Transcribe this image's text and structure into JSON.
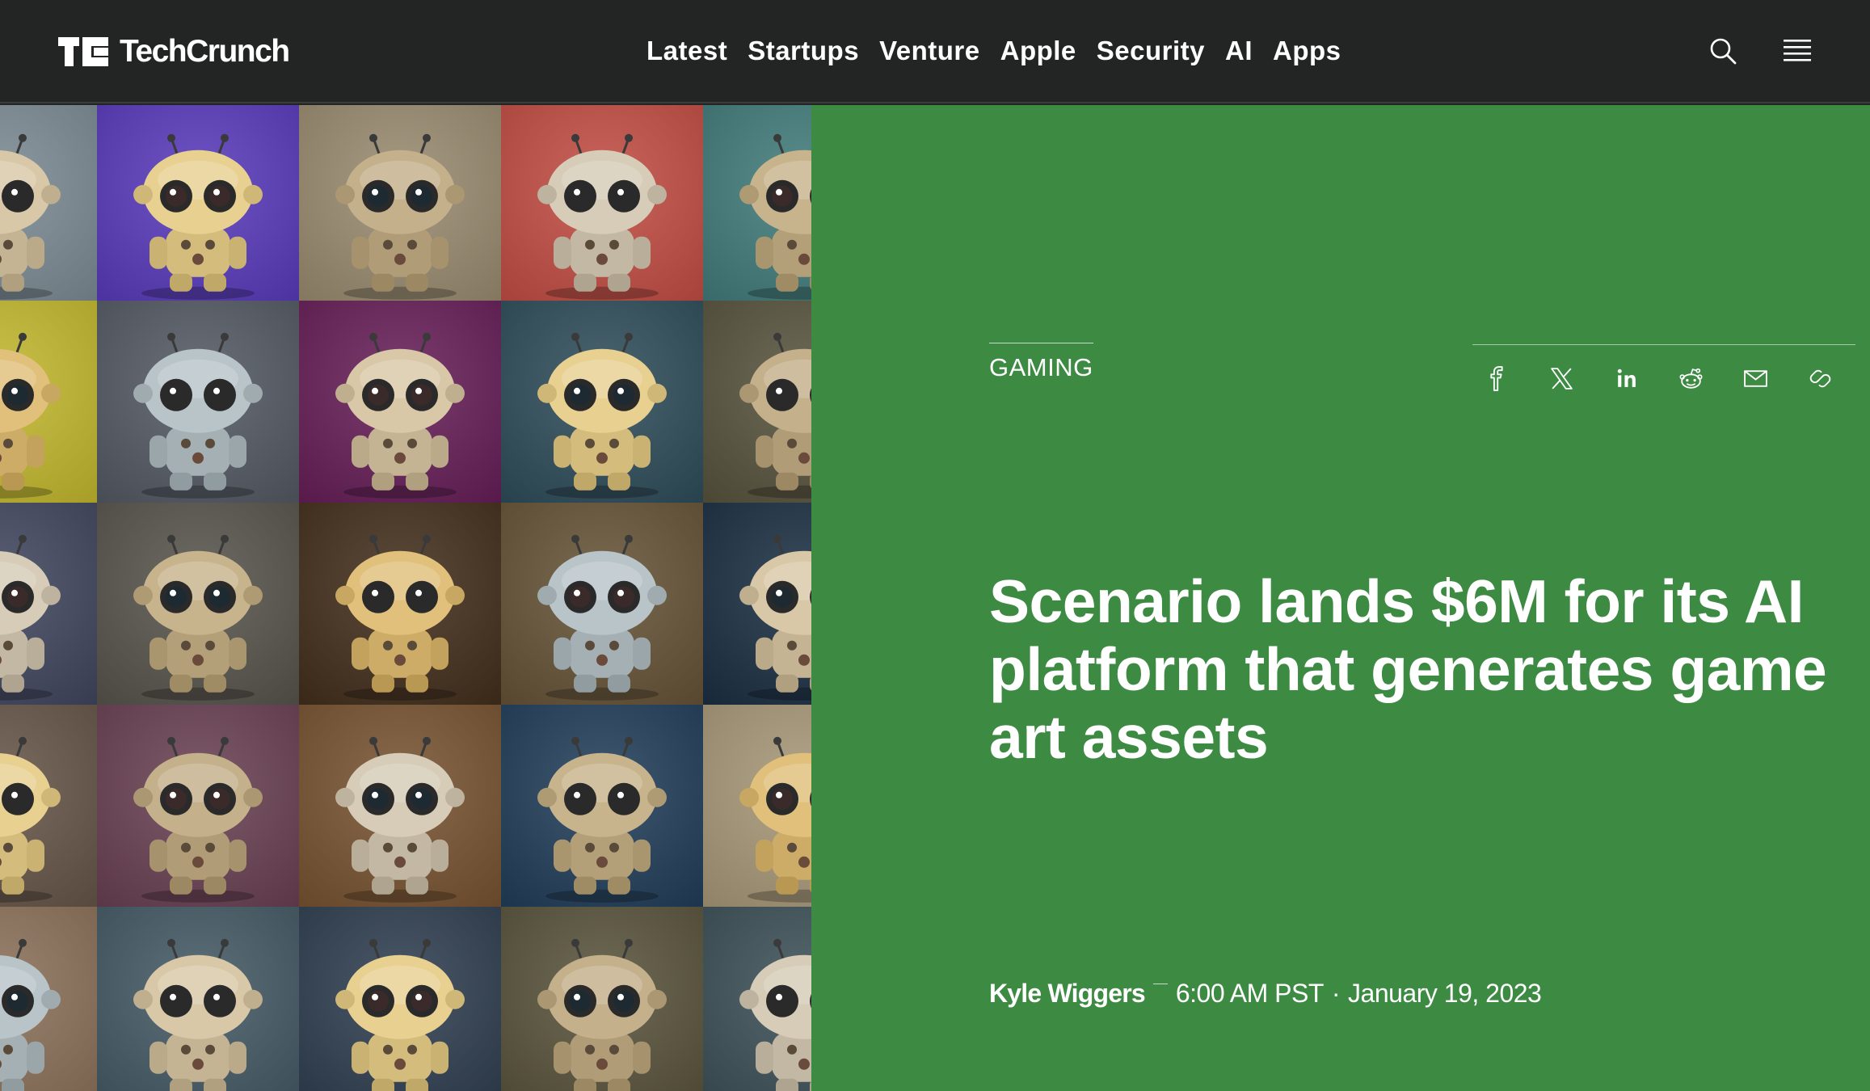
{
  "brand": {
    "name": "TechCrunch"
  },
  "nav": {
    "items": [
      {
        "label": "Latest"
      },
      {
        "label": "Startups"
      },
      {
        "label": "Venture"
      },
      {
        "label": "Apple"
      },
      {
        "label": "Security"
      },
      {
        "label": "AI"
      },
      {
        "label": "Apps"
      }
    ]
  },
  "header_actions": {
    "search_icon": "search-icon",
    "menu_icon": "hamburger-menu-icon"
  },
  "hero_image": {
    "subject": "grid of stylized cartoon robots",
    "icon": "image"
  },
  "article": {
    "category": "GAMING",
    "headline": "Scenario lands $6M for its AI platform that generates game art assets",
    "author": "Kyle Wiggers",
    "time": "6:00 AM PST",
    "separator": "·",
    "date": "January 19, 2023"
  },
  "share": {
    "icons": [
      "facebook-icon",
      "x-icon",
      "linkedin-icon",
      "reddit-icon",
      "email-icon",
      "link-icon"
    ]
  },
  "colors": {
    "header_bg": "#222524",
    "panel_bg": "#3d8a43",
    "text": "#ffffff"
  }
}
